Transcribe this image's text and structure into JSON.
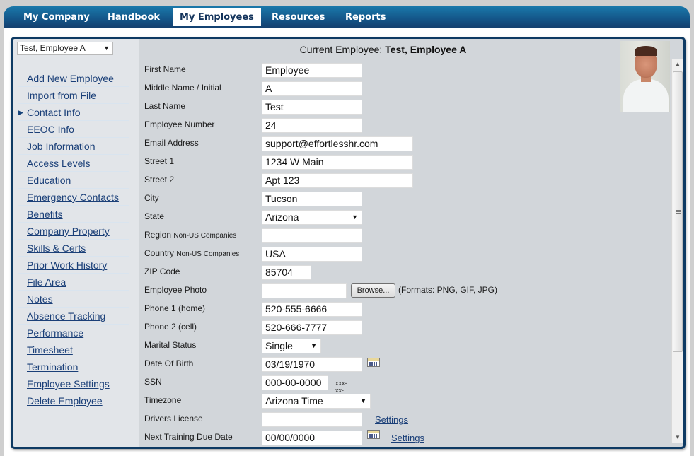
{
  "nav": {
    "items": [
      {
        "label": "My Company",
        "active": false
      },
      {
        "label": "Handbook",
        "active": false
      },
      {
        "label": "My Employees",
        "active": true
      },
      {
        "label": "Resources",
        "active": false
      },
      {
        "label": "Reports",
        "active": false
      }
    ]
  },
  "sidebar": {
    "employee_select": "Test, Employee A",
    "current_item": "Contact Info",
    "items": [
      {
        "label": "Add New Employee"
      },
      {
        "label": "Import from File"
      },
      {
        "label": "Contact Info"
      },
      {
        "label": "EEOC Info"
      },
      {
        "label": "Job Information"
      },
      {
        "label": "Access Levels"
      },
      {
        "label": "Education"
      },
      {
        "label": "Emergency Contacts"
      },
      {
        "label": "Benefits"
      },
      {
        "label": "Company Property"
      },
      {
        "label": "Skills & Certs"
      },
      {
        "label": "Prior Work History"
      },
      {
        "label": "File Area"
      },
      {
        "label": "Notes"
      },
      {
        "label": "Absence Tracking"
      },
      {
        "label": "Performance"
      },
      {
        "label": "Timesheet"
      },
      {
        "label": "Termination"
      },
      {
        "label": "Employee Settings"
      },
      {
        "label": "Delete Employee"
      }
    ]
  },
  "header": {
    "current_label": "Current Employee:",
    "current_name": "Test, Employee A"
  },
  "form": {
    "first_name": {
      "label": "First Name",
      "value": "Employee"
    },
    "middle_name": {
      "label": "Middle Name / Initial",
      "value": "A"
    },
    "last_name": {
      "label": "Last Name",
      "value": "Test"
    },
    "employee_number": {
      "label": "Employee Number",
      "value": "24"
    },
    "email": {
      "label": "Email Address",
      "value": "support@effortlesshr.com"
    },
    "street1": {
      "label": "Street 1",
      "value": "1234 W Main"
    },
    "street2": {
      "label": "Street 2",
      "value": "Apt 123"
    },
    "city": {
      "label": "City",
      "value": "Tucson"
    },
    "state": {
      "label": "State",
      "value": "Arizona"
    },
    "region": {
      "label": "Region",
      "note": "Non-US Companies",
      "value": ""
    },
    "country": {
      "label": "Country",
      "note": "Non-US Companies",
      "value": "USA"
    },
    "zip": {
      "label": "ZIP Code",
      "value": "85704"
    },
    "photo": {
      "label": "Employee Photo",
      "value": "",
      "browse": "Browse...",
      "formats": "(Formats: PNG, GIF, JPG)"
    },
    "phone1": {
      "label": "Phone 1 (home)",
      "value": "520-555-6666"
    },
    "phone2": {
      "label": "Phone 2 (cell)",
      "value": "520-666-7777"
    },
    "marital": {
      "label": "Marital Status",
      "value": "Single"
    },
    "dob": {
      "label": "Date Of Birth",
      "value": "03/19/1970"
    },
    "ssn": {
      "label": "SSN",
      "value": "000-00-0000",
      "hint": "xxx-xx-xxxx"
    },
    "timezone": {
      "label": "Timezone",
      "value": "Arizona Time"
    },
    "drivers_license": {
      "label": "Drivers License",
      "value": "",
      "settings": "Settings"
    },
    "next_training": {
      "label": "Next Training Due Date",
      "value": "00/00/0000",
      "settings": "Settings"
    }
  },
  "icons": {
    "dropdown": "chevron-down-icon",
    "calendar": "calendar-icon",
    "current_marker": "triangle-right-icon"
  }
}
